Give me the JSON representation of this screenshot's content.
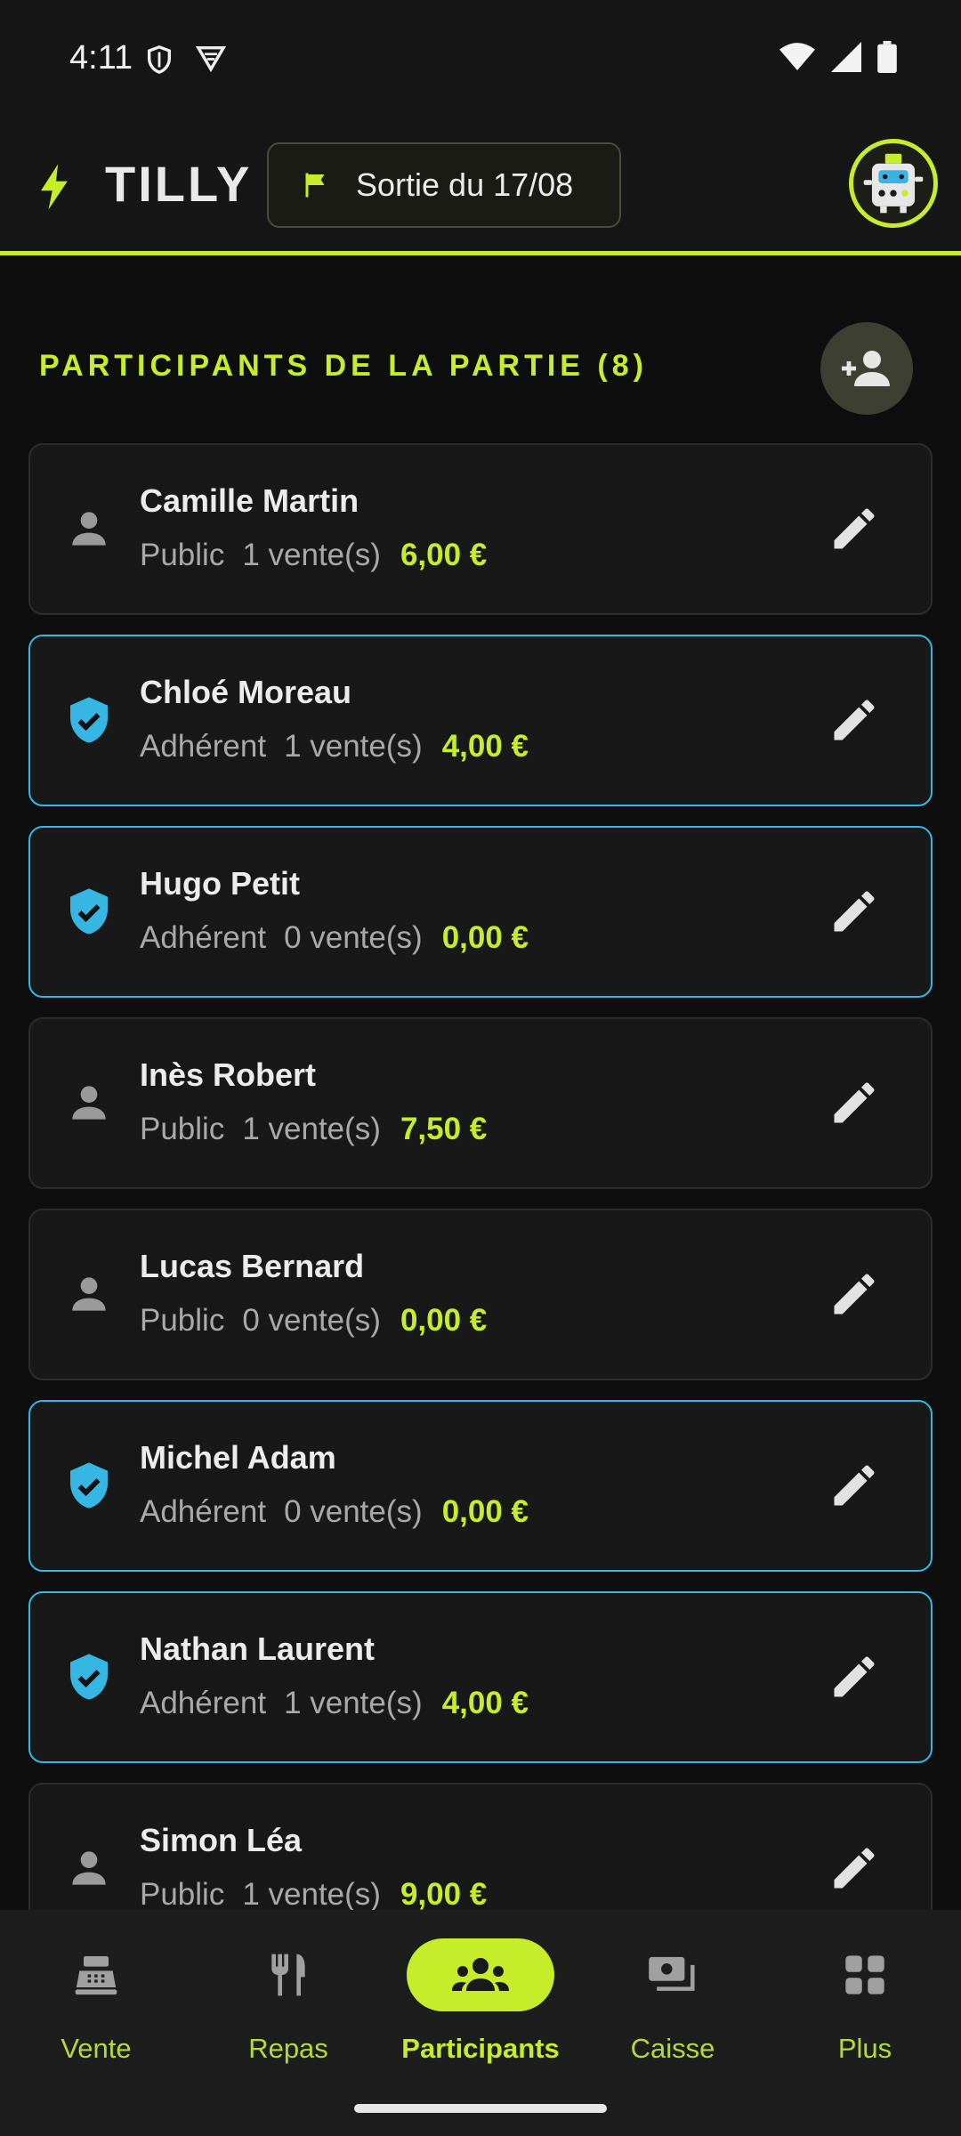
{
  "status_bar": {
    "time": "4:11"
  },
  "app_bar": {
    "brand": "TILLY",
    "session_label": "Sortie du 17/08"
  },
  "section": {
    "title": "PARTICIPANTS DE LA PARTIE (8)"
  },
  "participants": [
    {
      "name": "Camille Martin",
      "type": "Public",
      "sales": "1 vente(s)",
      "amount": "6,00 €"
    },
    {
      "name": "Chloé Moreau",
      "type": "Adhérent",
      "sales": "1 vente(s)",
      "amount": "4,00 €"
    },
    {
      "name": "Hugo Petit",
      "type": "Adhérent",
      "sales": "0 vente(s)",
      "amount": "0,00 €"
    },
    {
      "name": "Inès Robert",
      "type": "Public",
      "sales": "1 vente(s)",
      "amount": "7,50 €"
    },
    {
      "name": "Lucas Bernard",
      "type": "Public",
      "sales": "0 vente(s)",
      "amount": "0,00 €"
    },
    {
      "name": "Michel Adam",
      "type": "Adhérent",
      "sales": "0 vente(s)",
      "amount": "0,00 €"
    },
    {
      "name": "Nathan Laurent",
      "type": "Adhérent",
      "sales": "1 vente(s)",
      "amount": "4,00 €"
    },
    {
      "name": "Simon Léa",
      "type": "Public",
      "sales": "1 vente(s)",
      "amount": "9,00 €"
    }
  ],
  "nav": {
    "items": [
      {
        "label": "Vente",
        "icon": "cash-register-icon"
      },
      {
        "label": "Repas",
        "icon": "utensils-icon"
      },
      {
        "label": "Participants",
        "icon": "group-icon",
        "active": true
      },
      {
        "label": "Caisse",
        "icon": "payments-icon"
      },
      {
        "label": "Plus",
        "icon": "apps-icon"
      }
    ]
  },
  "colors": {
    "accent": "#c6ec2a",
    "member": "#35b6e3",
    "background": "#0e0e0e"
  }
}
